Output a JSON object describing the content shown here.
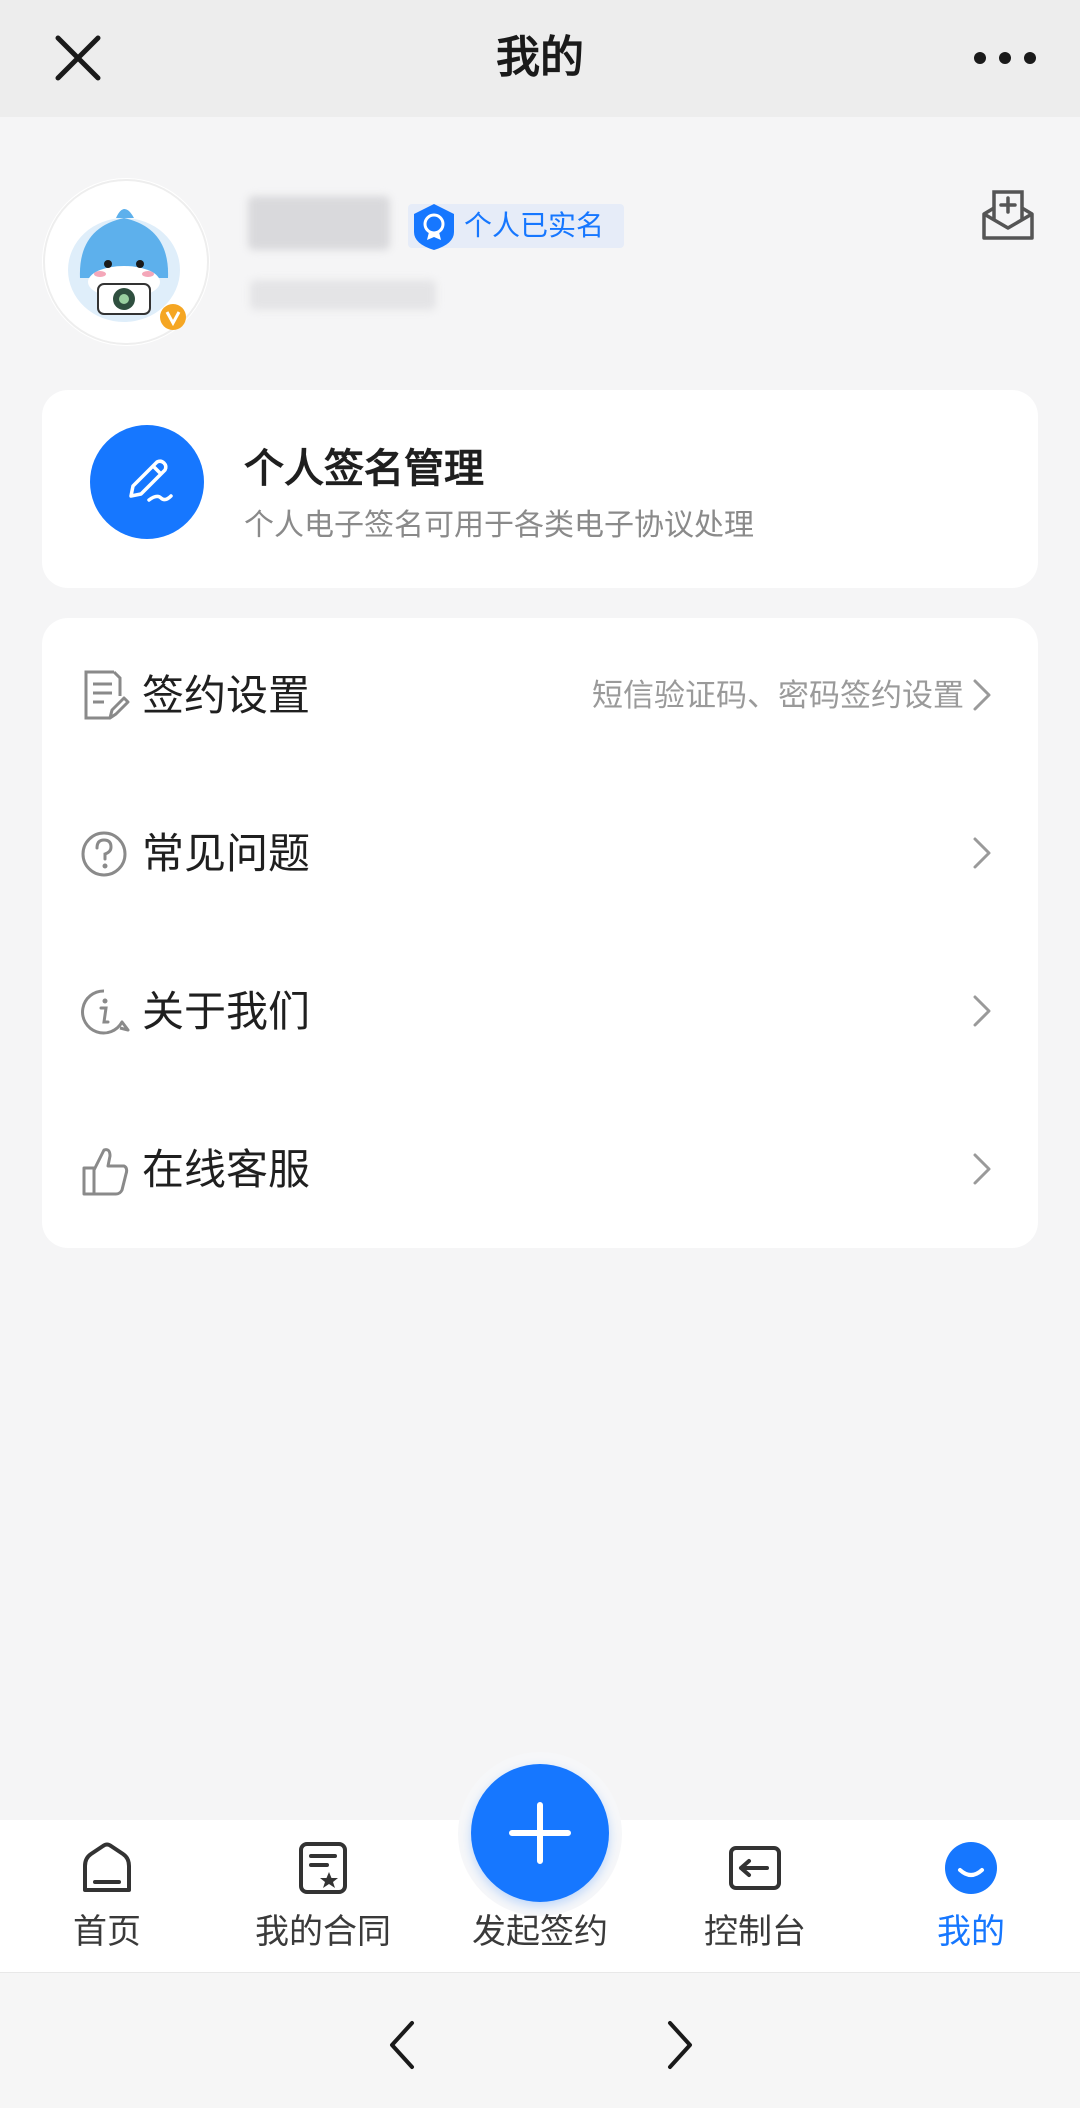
{
  "header": {
    "title": "我的"
  },
  "profile": {
    "verified_label": "个人已实名"
  },
  "signature_card": {
    "title": "个人签名管理",
    "subtitle": "个人电子签名可用于各类电子协议处理"
  },
  "menu": {
    "items": [
      {
        "icon": "document-edit-icon",
        "label": "签约设置",
        "hint": "短信验证码、密码签约设置"
      },
      {
        "icon": "question-circle-icon",
        "label": "常见问题",
        "hint": ""
      },
      {
        "icon": "info-circle-icon",
        "label": "关于我们",
        "hint": ""
      },
      {
        "icon": "thumbs-up-icon",
        "label": "在线客服",
        "hint": ""
      }
    ]
  },
  "tabbar": {
    "items": [
      {
        "icon": "home-icon",
        "label": "首页"
      },
      {
        "icon": "contract-icon",
        "label": "我的合同"
      },
      {
        "icon": "plus-icon",
        "label": "发起签约"
      },
      {
        "icon": "console-icon",
        "label": "控制台"
      },
      {
        "icon": "profile-smile-icon",
        "label": "我的"
      }
    ],
    "active_index": 4
  },
  "colors": {
    "accent": "#1677ff",
    "background": "#f5f5f6",
    "header_bg": "#ededed"
  }
}
